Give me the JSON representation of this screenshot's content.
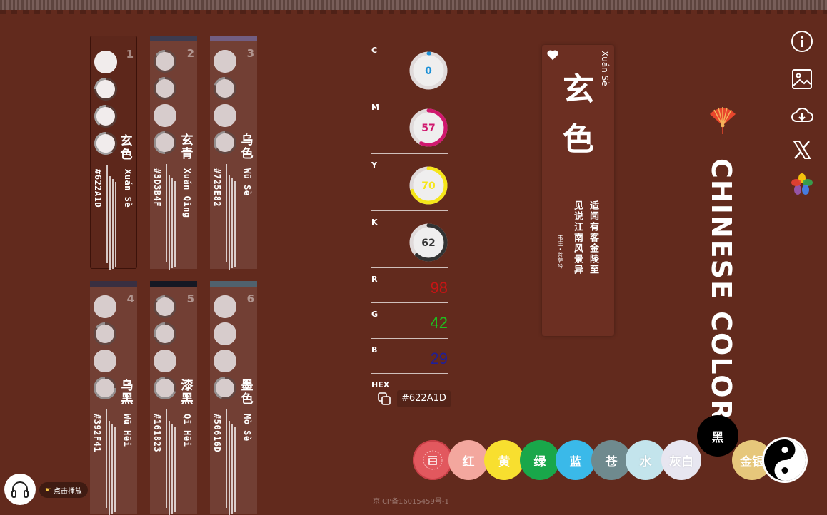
{
  "cards": [
    {
      "index": "1",
      "name": "玄色",
      "pinyin": "Xuán Sè",
      "hex": "#622A1D",
      "selected": true
    },
    {
      "index": "2",
      "name": "玄青",
      "pinyin": "Xuán Qīng",
      "hex": "#3D3B4F",
      "selected": false
    },
    {
      "index": "3",
      "name": "乌色",
      "pinyin": "Wū Sè",
      "hex": "#725E82",
      "selected": false
    },
    {
      "index": "4",
      "name": "乌黑",
      "pinyin": "Wū Hēi",
      "hex": "#392F41",
      "selected": false
    },
    {
      "index": "5",
      "name": "漆黑",
      "pinyin": "Qī Hēi",
      "hex": "#161823",
      "selected": false
    },
    {
      "index": "6",
      "name": "墨色",
      "pinyin": "Mò Sè",
      "hex": "#50616D",
      "selected": false
    }
  ],
  "cmyk": [
    {
      "label": "C",
      "value": "0",
      "pct": 0,
      "color": "#1a8fd6"
    },
    {
      "label": "M",
      "value": "57",
      "pct": 57,
      "color": "#d0186e"
    },
    {
      "label": "Y",
      "value": "70",
      "pct": 70,
      "color": "#f6e619"
    },
    {
      "label": "K",
      "value": "62",
      "pct": 62,
      "color": "#333333"
    }
  ],
  "rgb": [
    {
      "label": "R",
      "value": "98",
      "color": "#c81414"
    },
    {
      "label": "G",
      "value": "42",
      "color": "#1fbf1f"
    },
    {
      "label": "B",
      "value": "29",
      "color": "#1e1e9a"
    }
  ],
  "hex_label": "HEX",
  "hex_value": "#622A1D",
  "poem": {
    "pinyin": "Xuán Sè",
    "name_chars": [
      "玄",
      "色"
    ],
    "lines": [
      "适闻有客金陵至",
      "见说江南风景异"
    ],
    "author": "韦庄・菩萨吟"
  },
  "site_title": "CHINESE COLOR",
  "palette": [
    {
      "label": "红",
      "color": "#f3a79e"
    },
    {
      "label": "黄",
      "color": "#f8df2f"
    },
    {
      "label": "绿",
      "color": "#19a74a"
    },
    {
      "label": "蓝",
      "color": "#3ab9e9"
    },
    {
      "label": "苍",
      "color": "#6f8a8e"
    },
    {
      "label": "水",
      "color": "#c3e4ec"
    },
    {
      "label": "灰白",
      "color": "#e7e6f0"
    },
    {
      "label": "金银",
      "color": "#e6c77b"
    }
  ],
  "black_label": "黑",
  "play_label": "点击播放",
  "icp": "京ICP备16015459号-1",
  "page_bg": "#622A1D"
}
